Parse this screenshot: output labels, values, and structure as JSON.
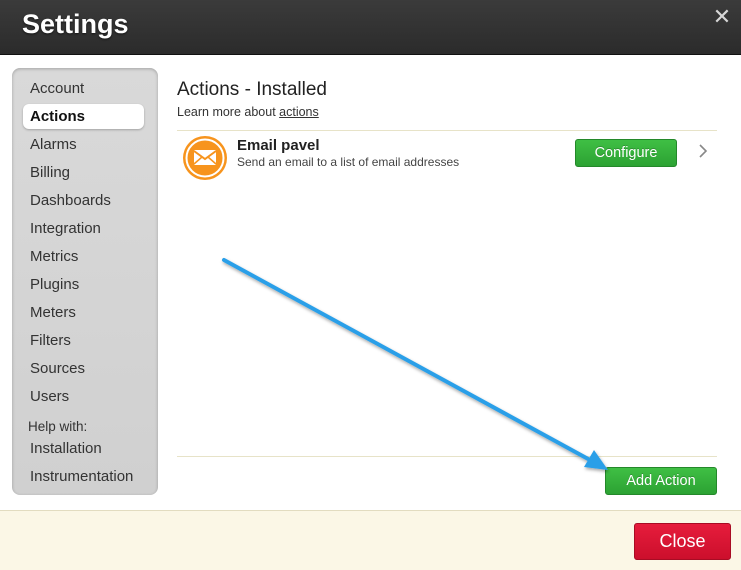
{
  "window": {
    "title": "Settings",
    "close_icon": "close-x-icon"
  },
  "sidebar": {
    "items": [
      {
        "label": "Account",
        "active": false
      },
      {
        "label": "Actions",
        "active": true
      },
      {
        "label": "Alarms",
        "active": false
      },
      {
        "label": "Billing",
        "active": false
      },
      {
        "label": "Dashboards",
        "active": false
      },
      {
        "label": "Integration",
        "active": false
      },
      {
        "label": "Metrics",
        "active": false
      },
      {
        "label": "Plugins",
        "active": false
      },
      {
        "label": "Meters",
        "active": false
      },
      {
        "label": "Filters",
        "active": false
      },
      {
        "label": "Sources",
        "active": false
      },
      {
        "label": "Users",
        "active": false
      }
    ],
    "help_label": "Help with:",
    "help_items": [
      {
        "label": "Installation"
      },
      {
        "label": "Instrumentation"
      }
    ]
  },
  "main": {
    "heading": "Actions - Installed",
    "learn_more_prefix": "Learn more about ",
    "learn_more_link": "actions",
    "actions": [
      {
        "icon": "envelope-icon",
        "title": "Email pavel",
        "description": "Send an email to a list of email addresses",
        "configure_label": "Configure"
      }
    ],
    "add_action_label": "Add Action"
  },
  "footer": {
    "close_label": "Close"
  },
  "colors": {
    "titlebar": "#2f2f2f",
    "green_button": "#34b33a",
    "red_button": "#d9142f",
    "icon_orange": "#f7941d",
    "annotation_arrow": "#2a9fe8",
    "footer_bg": "#fbf7e6"
  }
}
